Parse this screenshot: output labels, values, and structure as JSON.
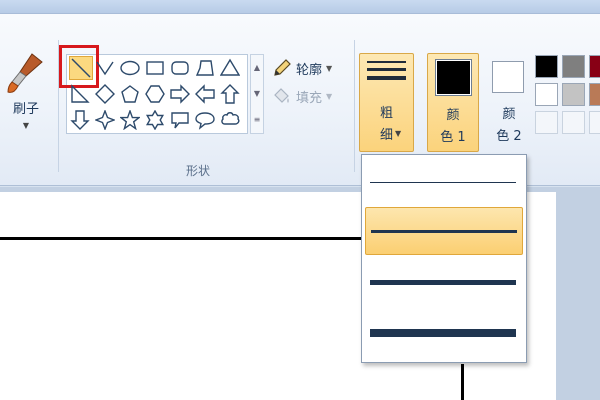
{
  "brush": {
    "label": "刷子"
  },
  "shapes": {
    "group_title": "形状",
    "outline_label": "轮廓",
    "fill_label": "填充",
    "selected": "line"
  },
  "size": {
    "label_1": "粗",
    "label_2": "细"
  },
  "color1": {
    "label_1": "颜",
    "label_2": "色 1",
    "value": "#000000"
  },
  "color2": {
    "label_1": "颜",
    "label_2": "色 2",
    "value": "#ffffff"
  },
  "palette": [
    "#000000",
    "#7f7f7f",
    "#880015",
    "#ffffff",
    "#c3c3c3",
    "#b97a57"
  ],
  "size_options": [
    {
      "name": "1px"
    },
    {
      "name": "3px",
      "selected": true
    },
    {
      "name": "5px"
    },
    {
      "name": "8px"
    }
  ],
  "colors": {
    "accent": "#fbd37c",
    "highlight": "#d7181c",
    "ribbon_text": "#1e395b"
  }
}
